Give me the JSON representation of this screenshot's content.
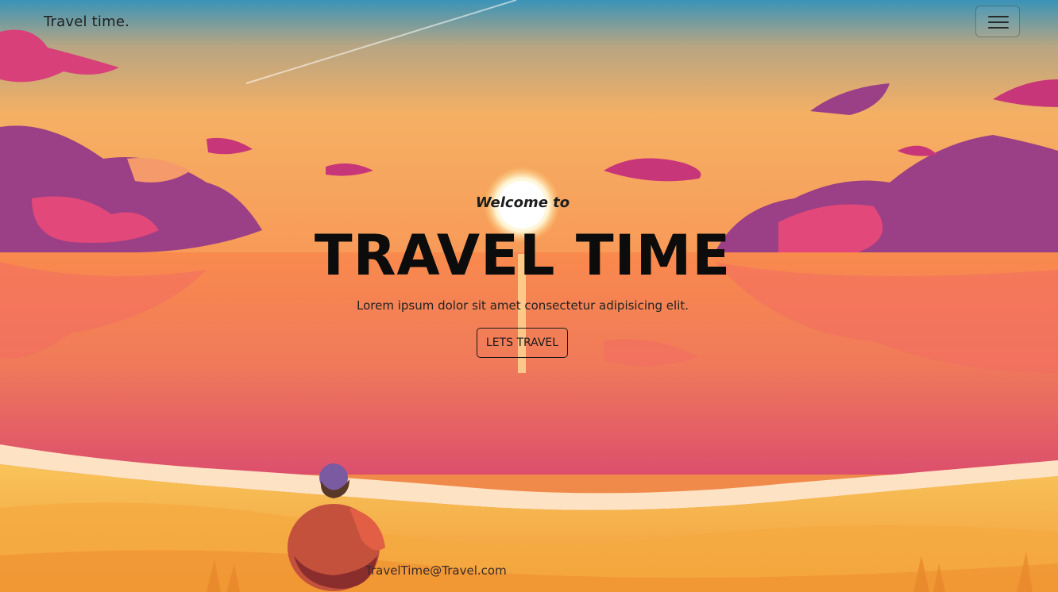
{
  "navbar": {
    "brand": "Travel time.",
    "toggler_icon": "hamburger-menu-icon"
  },
  "hero": {
    "welcome": "Welcome to",
    "title": "TRAVEL TIME",
    "subtitle": "Lorem ipsum dolor sit amet consectetur adipisicing elit.",
    "cta_label": "LETS TRAVEL"
  },
  "footer": {
    "email": "TravelTime@Travel.com"
  },
  "colors": {
    "sky_top": "#3a93b8",
    "sky_mid": "#f7b15e",
    "sea": "#f27e56",
    "sand": "#f6b74c",
    "clouds": "#c7367a"
  }
}
